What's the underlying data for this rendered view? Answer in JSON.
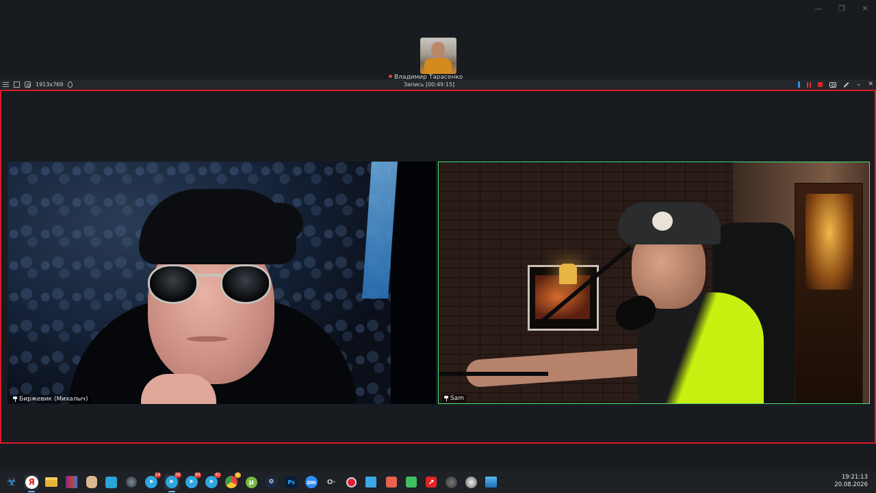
{
  "window": {
    "minimize_glyph": "—",
    "restore_glyph": "❐",
    "close_glyph": "✕"
  },
  "top_participant": {
    "label": "Владимир Тарасенко"
  },
  "recorder": {
    "resolution": "1913x769",
    "title": "Запись [00:49:15]",
    "chevron_glyph": "⌄",
    "close_glyph": "✕"
  },
  "tiles": {
    "left": {
      "name": "Биржевик (Михалыч)"
    },
    "right": {
      "name": "Sam"
    }
  },
  "taskbar": {
    "items": [
      {
        "id": "biohazard",
        "glyph": "☣"
      },
      {
        "id": "yandex",
        "glyph": "Я"
      },
      {
        "id": "explorer",
        "glyph": ""
      },
      {
        "id": "winrar",
        "glyph": ""
      },
      {
        "id": "hand-app",
        "glyph": ""
      },
      {
        "id": "grid-app",
        "glyph": ""
      },
      {
        "id": "globe-app",
        "glyph": ""
      },
      {
        "id": "telegram-1",
        "glyph": "➤",
        "badge": "24"
      },
      {
        "id": "telegram-2",
        "glyph": "➤",
        "badge": "26"
      },
      {
        "id": "telegram-3",
        "glyph": "➤",
        "badge": "99"
      },
      {
        "id": "telegram-4",
        "glyph": "➤",
        "badge": "42"
      },
      {
        "id": "chrome",
        "glyph": "",
        "badge": "2"
      },
      {
        "id": "utorrent",
        "glyph": "μ"
      },
      {
        "id": "steam",
        "glyph": "⚙"
      },
      {
        "id": "photoshop",
        "glyph": "Ps"
      },
      {
        "id": "zoom",
        "glyph": "zm"
      },
      {
        "id": "obs",
        "glyph": "O·"
      },
      {
        "id": "recorder",
        "glyph": ""
      },
      {
        "id": "docs",
        "glyph": ""
      },
      {
        "id": "app-orange",
        "glyph": ""
      },
      {
        "id": "app-green",
        "glyph": ""
      },
      {
        "id": "app-arrow",
        "glyph": "↗"
      },
      {
        "id": "camera-app",
        "glyph": "",
        "badge": ""
      },
      {
        "id": "camera-app-2",
        "glyph": ""
      },
      {
        "id": "pictures",
        "glyph": ""
      }
    ]
  },
  "tray": {
    "time": "19:21:13",
    "date": "20.08.2026"
  }
}
